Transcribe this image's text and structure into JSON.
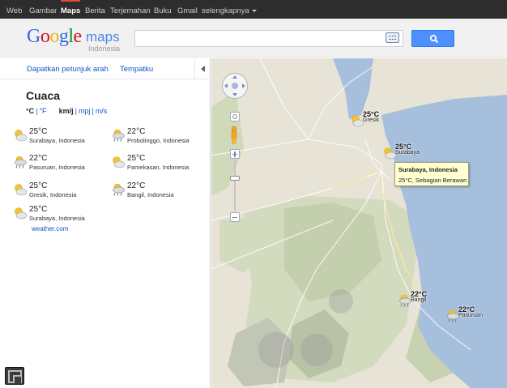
{
  "topbar": {
    "items": [
      {
        "label": "Web"
      },
      {
        "label": "Gambar"
      },
      {
        "label": "Maps"
      },
      {
        "label": "Berita"
      },
      {
        "label": "Terjemahan"
      },
      {
        "label": "Buku"
      },
      {
        "label": "Gmail"
      },
      {
        "label": "selengkapnya"
      }
    ],
    "active": "Maps"
  },
  "header": {
    "logo": {
      "letters": [
        "G",
        "o",
        "o",
        "g",
        "l",
        "e"
      ],
      "product": "maps",
      "region": "Indonesia"
    },
    "search": {
      "value": "",
      "placeholder": ""
    },
    "keyboard_icon": "keyboard-icon",
    "search_icon": "magnifier-icon",
    "colors": {
      "search_button": "#4d90fe",
      "topbar": "#2d2d2d"
    }
  },
  "panel": {
    "links": {
      "directions": "Dapatkan petunjuk arah",
      "my_places": "Tempatku"
    },
    "weather": {
      "title": "Cuaca",
      "units": {
        "celsius": "°C",
        "fahrenheit": "°F",
        "kmh": "km/j",
        "mph": "mpj",
        "ms": "m/s",
        "sep": "|"
      },
      "items": [
        {
          "temp": "25°C",
          "place": "Surabaya, Indonesia",
          "icon": "partly-cloudy-icon"
        },
        {
          "temp": "22°C",
          "place": "Probolinggo, Indonesia",
          "icon": "rain-icon"
        },
        {
          "temp": "22°C",
          "place": "Pasuruan, Indonesia",
          "icon": "rain-icon"
        },
        {
          "temp": "25°C",
          "place": "Pamekasan, Indonesia",
          "icon": "partly-cloudy-icon"
        },
        {
          "temp": "25°C",
          "place": "Gresik, Indonesia",
          "icon": "partly-cloudy-icon"
        },
        {
          "temp": "22°C",
          "place": "Bangil, Indonesia",
          "icon": "rain-icon"
        },
        {
          "temp": "25°C",
          "place": "Surabaya, Indonesia",
          "icon": "partly-cloudy-icon"
        }
      ],
      "source": "weather.com"
    }
  },
  "map": {
    "markers": [
      {
        "temp": "25°C",
        "place": "Gresik",
        "icon": "partly-cloudy-icon"
      },
      {
        "temp": "25°C",
        "place": "Surabaya",
        "icon": "partly-cloudy-icon"
      },
      {
        "temp": "22°C",
        "place": "Bangil",
        "icon": "rain-icon"
      },
      {
        "temp": "22°C",
        "place": "Pasuruan",
        "icon": "rain-icon"
      }
    ],
    "tooltip": {
      "title": "Surabaya, Indonesia",
      "detail": "25°C, Sebagian Berawan"
    },
    "colors": {
      "sea": "#a5bfdd",
      "land": "#e7e3d6",
      "forest": "#cbd6b3",
      "road": "#ffffff"
    }
  }
}
